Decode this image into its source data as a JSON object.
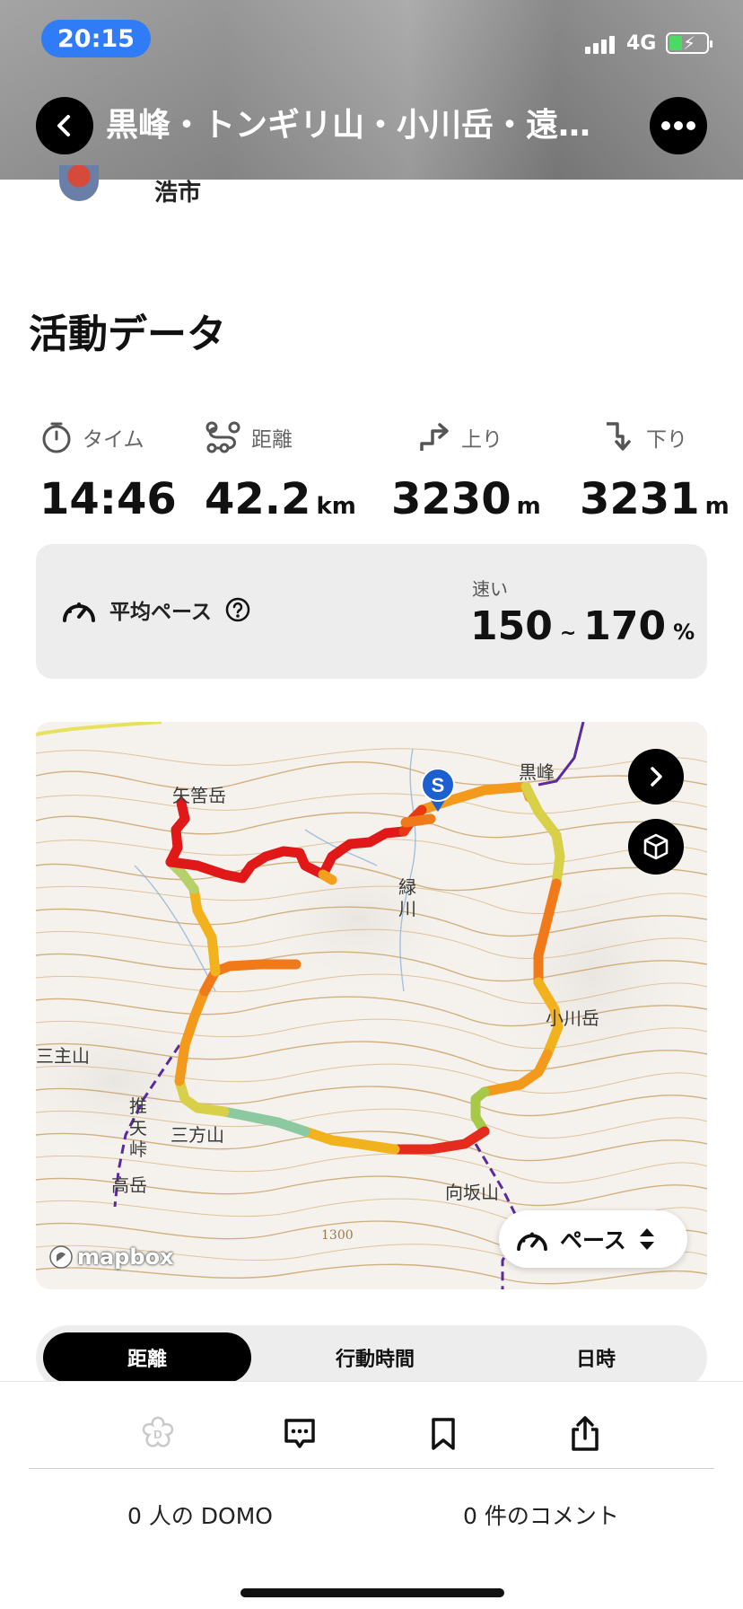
{
  "status_bar": {
    "time": "20:15",
    "network": "4G",
    "battery_level": 0.3
  },
  "header": {
    "title": "黒峰・トンギリ山・小川岳・遠…",
    "back_icon": "chevron-left-icon",
    "more_icon": "more-dots-icon"
  },
  "user": {
    "name": "浩市"
  },
  "activity": {
    "section_title": "活動データ",
    "stats": [
      {
        "icon": "stopwatch-icon",
        "label": "タイム",
        "value": "14:46",
        "unit": ""
      },
      {
        "icon": "route-icon",
        "label": "距離",
        "value": "42.2",
        "unit": "km"
      },
      {
        "icon": "ascent-icon",
        "label": "上り",
        "value": "3230",
        "unit": "m"
      },
      {
        "icon": "descent-icon",
        "label": "下り",
        "value": "3231",
        "unit": "m"
      }
    ],
    "pace": {
      "label": "平均ペース",
      "speed_label": "速い",
      "min": "150",
      "tilde": "~",
      "max": "170",
      "unit": "%"
    }
  },
  "map": {
    "labels": {
      "yahazu": "矢筈岳",
      "kuromine": "黒峰",
      "midori_1": "緑",
      "midori_2": "川",
      "ogawa": "小川岳",
      "mitsukata": "三方山",
      "sanshu": "三主山",
      "shii_1": "推",
      "shii_2": "矢",
      "shii_3": "峠",
      "takadake": "高岳",
      "mukaisaka": "向坂山",
      "elev": "1300"
    },
    "start_marker": "S",
    "pace_toggle_label": "ペース",
    "attribution": "mapbox",
    "colors": {
      "slow": "#e0101a",
      "mid": "#f39a1c",
      "fast": "#7cc7a8"
    }
  },
  "tabs": {
    "items": [
      "距離",
      "行動時間",
      "日時"
    ],
    "active_index": 0
  },
  "bottom": {
    "domo_count": "0 人の DOMO",
    "comment_count": "0 件のコメント"
  }
}
